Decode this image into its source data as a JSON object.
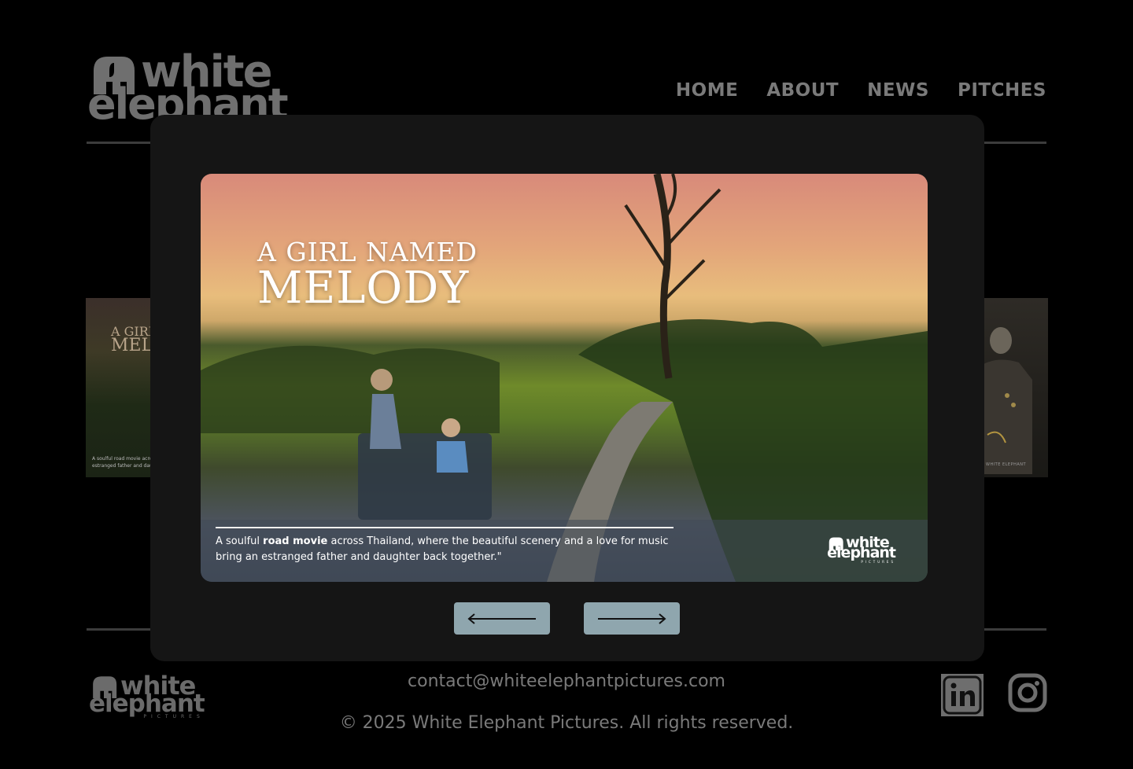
{
  "header": {
    "logo": {
      "line1": "white",
      "line2": "elephant"
    },
    "nav": [
      {
        "label": "HOME"
      },
      {
        "label": "ABOUT"
      },
      {
        "label": "NEWS"
      },
      {
        "label": "PITCHES"
      }
    ]
  },
  "carousel": {
    "left_card": {
      "title1": "A GIRL",
      "title2": "MEL",
      "caption1": "A soulful road movie acros",
      "caption2": "estranged father and daugh"
    },
    "right_card": {
      "caption": "WHITE ELEPHANT"
    }
  },
  "modal": {
    "slide": {
      "title_line1": "A GIRL NAMED",
      "title_line2": "MELODY",
      "caption_pre": "A soulful ",
      "caption_bold": "road movie",
      "caption_post": " across Thailand, where the beautiful scenery and a love for music bring an estranged father and daughter back together.\"",
      "logo": {
        "line1": "white",
        "line2": "elephant",
        "sub": "PICTURES"
      }
    },
    "prev_label": "previous",
    "next_label": "next"
  },
  "footer": {
    "logo": {
      "line1": "white",
      "line2": "elephant",
      "sub": "PICTURES"
    },
    "contact": "contact@whiteelephantpictures.com",
    "copyright": "© 2025 White Elephant Pictures. All rights reserved.",
    "social": [
      {
        "icon": "linkedin-icon"
      },
      {
        "icon": "instagram-icon"
      }
    ]
  }
}
